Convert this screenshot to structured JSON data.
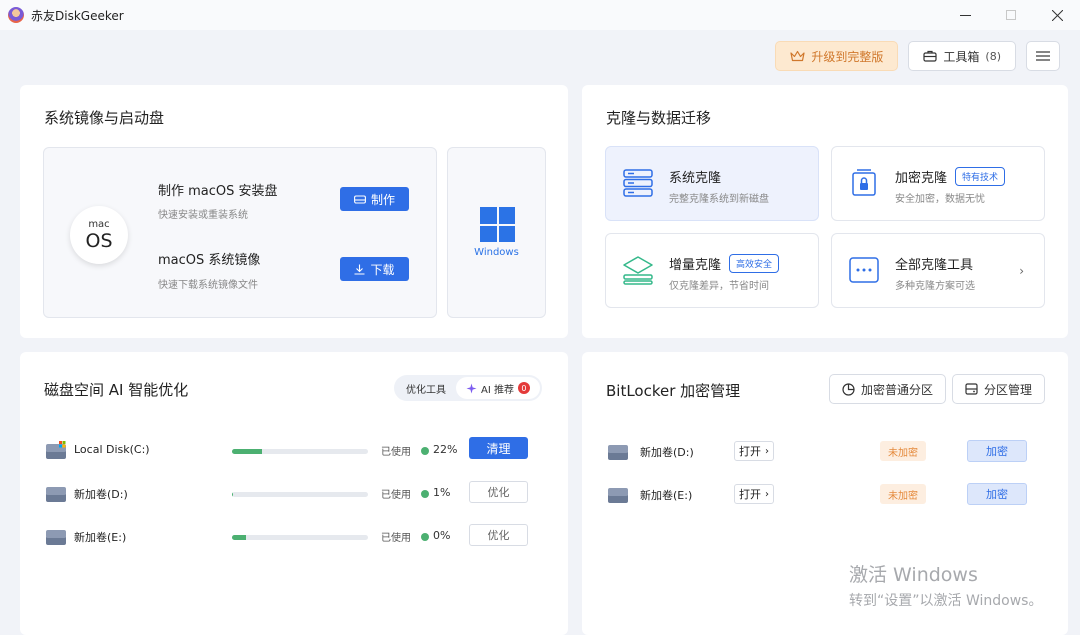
{
  "app": {
    "title": "赤友DiskGeeker"
  },
  "window": {
    "icons": [
      "minimize-icon",
      "maximize-icon",
      "close-icon"
    ]
  },
  "topbar": {
    "upgrade_label": "升级到完整版",
    "toolbox_label": "工具箱",
    "toolbox_count": "(8)"
  },
  "system_image": {
    "title": "系统镜像与启动盘",
    "os_icon": {
      "small": "mac",
      "big": "OS"
    },
    "items": [
      {
        "title": "制作 macOS 安装盘",
        "subtitle": "快速安装或重装系统",
        "button": "制作"
      },
      {
        "title": "macOS 系统镜像",
        "subtitle": "快速下载系统镜像文件",
        "button": "下载"
      }
    ],
    "windows_label": "Windows"
  },
  "clone": {
    "title": "克隆与数据迁移",
    "tiles": [
      {
        "title": "系统克隆",
        "subtitle": "完整克隆系统到新磁盘",
        "tag": ""
      },
      {
        "title": "加密克隆",
        "subtitle": "安全加密，数据无忧",
        "tag": "特有技术"
      },
      {
        "title": "增量克隆",
        "subtitle": "仅克隆差异，节省时间",
        "tag": "高效安全"
      },
      {
        "title": "全部克隆工具",
        "subtitle": "多种克隆方案可选",
        "tag": ""
      }
    ],
    "arrow": "›"
  },
  "disk_optimize": {
    "title": "磁盘空间 AI 智能优化",
    "tabs": {
      "tool": "优化工具",
      "ai": "AI 推荐",
      "ai_badge": "0"
    },
    "used_label": "已使用",
    "disks": [
      {
        "name": "Local Disk(C:)",
        "percent": "22%",
        "usage": 22,
        "action": "清理"
      },
      {
        "name": "新加卷(D:)",
        "percent": "1%",
        "usage": 1,
        "action": "优化"
      },
      {
        "name": "新加卷(E:)",
        "percent": "0%",
        "usage": 0,
        "action": "优化"
      }
    ],
    "colors": {
      "bar": "#4cb071",
      "primary": "#2f6ee6"
    }
  },
  "bitlocker": {
    "title": "BitLocker 加密管理",
    "encrypt_partition_label": "加密普通分区",
    "partition_manage_label": "分区管理",
    "volumes": [
      {
        "name": "新加卷(D:)",
        "open": "打开",
        "status": "未加密",
        "action": "加密"
      },
      {
        "name": "新加卷(E:)",
        "open": "打开",
        "status": "未加密",
        "action": "加密"
      }
    ]
  },
  "watermark": {
    "line1": "激活 Windows",
    "line2": "转到“设置”以激活 Windows。"
  }
}
